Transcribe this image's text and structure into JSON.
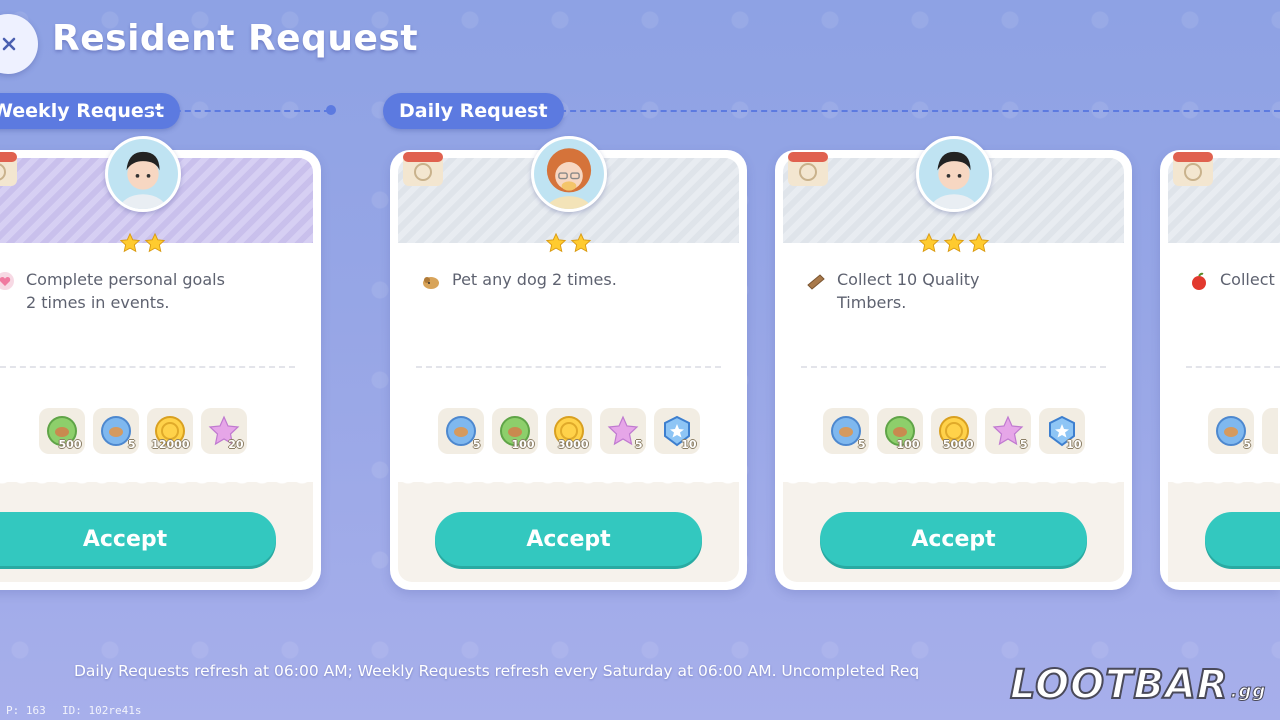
{
  "header": {
    "title": "Resident Request",
    "back_icon": "close-icon"
  },
  "sections": {
    "weekly_label": "Weekly Request",
    "daily_label": "Daily Request"
  },
  "cards": [
    {
      "type": "weekly",
      "stars": 2,
      "task_icon": "heart-badge-icon",
      "task_line1": "Complete personal goals",
      "task_line2": "2 times in events.",
      "rewards": [
        {
          "icon": "green-token-icon",
          "count": "500"
        },
        {
          "icon": "blue-token-icon",
          "count": "5"
        },
        {
          "icon": "gold-coin-icon",
          "count": "12000"
        },
        {
          "icon": "pink-star-icon",
          "count": "20"
        }
      ],
      "accept_label": "Accept"
    },
    {
      "type": "daily",
      "stars": 2,
      "task_icon": "dog-icon",
      "task_line1": "Pet any dog 2 times.",
      "task_line2": "",
      "rewards": [
        {
          "icon": "blue-token-icon",
          "count": "5"
        },
        {
          "icon": "green-token-icon",
          "count": "100"
        },
        {
          "icon": "gold-coin-icon",
          "count": "3000"
        },
        {
          "icon": "pink-star-icon",
          "count": "5"
        },
        {
          "icon": "blue-badge-icon",
          "count": "10"
        }
      ],
      "accept_label": "Accept"
    },
    {
      "type": "daily",
      "stars": 3,
      "task_icon": "timber-icon",
      "task_line1": "Collect 10 Quality",
      "task_line2": "Timbers.",
      "rewards": [
        {
          "icon": "blue-token-icon",
          "count": "5"
        },
        {
          "icon": "green-token-icon",
          "count": "100"
        },
        {
          "icon": "gold-coin-icon",
          "count": "5000"
        },
        {
          "icon": "pink-star-icon",
          "count": "5"
        },
        {
          "icon": "blue-badge-icon",
          "count": "10"
        }
      ],
      "accept_label": "Accept"
    },
    {
      "type": "daily",
      "task_icon": "apple-icon",
      "task_line1": "Collect",
      "rewards": [
        {
          "icon": "blue-token-icon",
          "count": "5"
        }
      ]
    }
  ],
  "footer_note": "Daily Requests refresh at 06:00 AM; Weekly Requests refresh every Saturday at 06:00 AM. Uncompleted Req",
  "debug": {
    "p_label": "P: 163",
    "id_label": "ID: 102re41s"
  },
  "watermark": {
    "text": "LOOTBAR",
    "suffix": ".gg"
  }
}
